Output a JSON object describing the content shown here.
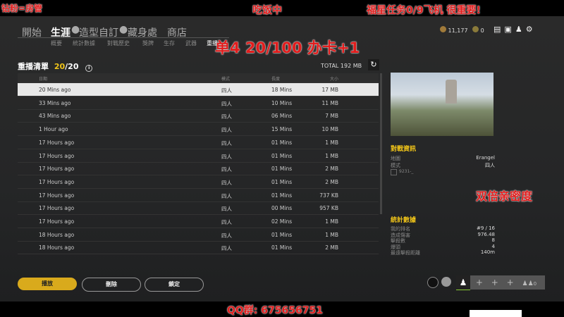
{
  "overlay": {
    "top_left": "钻粉=房管",
    "top_center": "吃饭中",
    "top_right": "福星任务0/9飞机 很重要!",
    "center": "单4 20/100 办卡+1",
    "right": "双倍亲密度",
    "bottom": "QQ群: 675656751"
  },
  "nav": {
    "tabs": [
      "開始",
      "生涯",
      "造型自訂",
      "藏身處",
      "商店"
    ],
    "sub": [
      "概要",
      "統計數據",
      "對戰歷史",
      "獎牌",
      "生存",
      "武器",
      "重播"
    ]
  },
  "currency": {
    "bp": "11,177",
    "gcoin": "0"
  },
  "replay": {
    "title": "重播清單",
    "count": "20",
    "max": "/20",
    "total": "TOTAL 192 MB",
    "headers": [
      "日期",
      "模式",
      "長度",
      "大小"
    ],
    "rows": [
      [
        "20 Mins ago",
        "四人",
        "18 Mins",
        "17 MB"
      ],
      [
        "33 Mins ago",
        "四人",
        "10 Mins",
        "11 MB"
      ],
      [
        "43 Mins ago",
        "四人",
        "06 Mins",
        "7 MB"
      ],
      [
        "1 Hour ago",
        "四人",
        "15 Mins",
        "10 MB"
      ],
      [
        "17 Hours ago",
        "四人",
        "01 Mins",
        "1 MB"
      ],
      [
        "17 Hours ago",
        "四人",
        "01 Mins",
        "1 MB"
      ],
      [
        "17 Hours ago",
        "四人",
        "01 Mins",
        "2 MB"
      ],
      [
        "17 Hours ago",
        "四人",
        "01 Mins",
        "2 MB"
      ],
      [
        "17 Hours ago",
        "四人",
        "01 Mins",
        "737 KB"
      ],
      [
        "17 Hours ago",
        "四人",
        "00 Mins",
        "957 KB"
      ],
      [
        "17 Hours ago",
        "四人",
        "02 Mins",
        "1 MB"
      ],
      [
        "18 Hours ago",
        "四人",
        "01 Mins",
        "1 MB"
      ],
      [
        "18 Hours ago",
        "四人",
        "01 Mins",
        "2 MB"
      ]
    ]
  },
  "match": {
    "title": "對戰資訊",
    "map_label": "地圖",
    "map": "Erangel",
    "mode_label": "模式",
    "mode": "四人",
    "player": "9231-_"
  },
  "stats": {
    "title": "統計數據",
    "items": [
      [
        "我的排名",
        "#9 / 16"
      ],
      [
        "造成傷害",
        "976.48"
      ],
      [
        "擊殺數",
        "8"
      ],
      [
        "爆頭",
        "4"
      ],
      [
        "最遠擊殺距離",
        "140m"
      ]
    ]
  },
  "buttons": {
    "play": "播放",
    "delete": "刪除",
    "lock": "鎖定"
  },
  "party": {
    "count": "0"
  }
}
